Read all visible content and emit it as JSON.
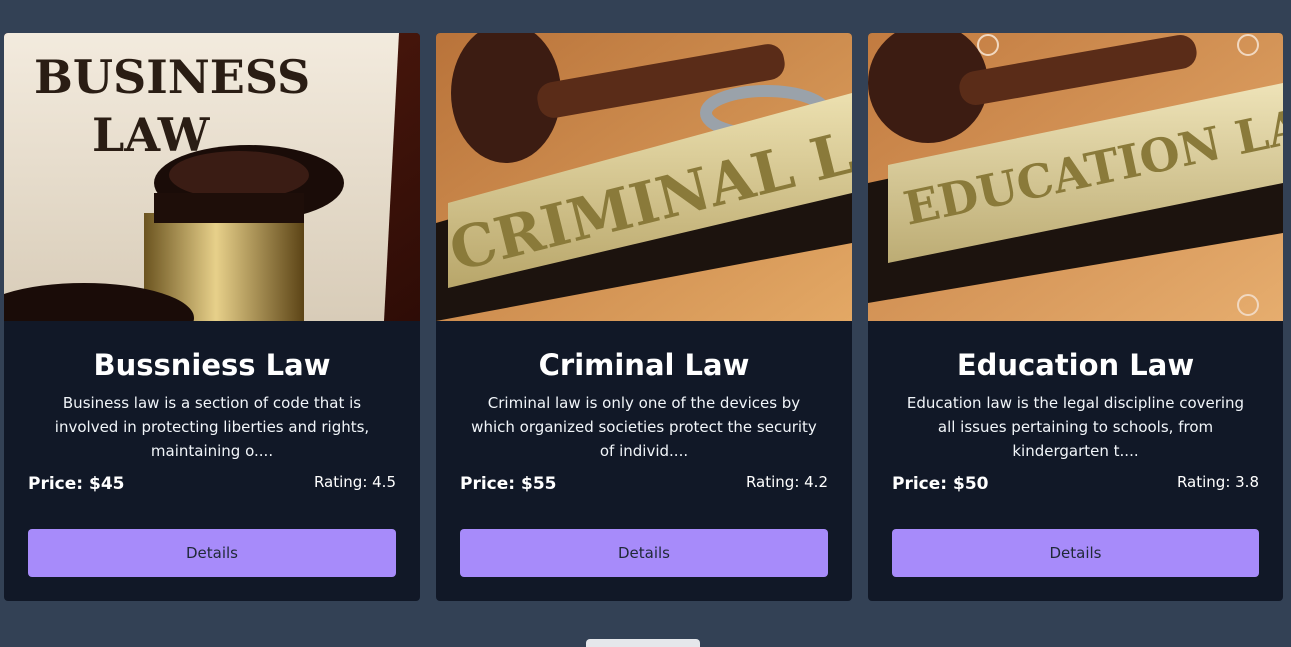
{
  "cards": [
    {
      "title": "Bussniess Law",
      "description": "Business law is a section of code that is involved in protecting liberties and rights, maintaining o....",
      "price": "Price: $45",
      "rating": "Rating: 4.5",
      "button_label": "Details",
      "image_text_1": "BUSINESS",
      "image_text_2": "LAW"
    },
    {
      "title": "Criminal Law",
      "description": "Criminal law is only one of the devices by which organized societies protect the security of individ....",
      "price": "Price: $55",
      "rating": "Rating: 4.2",
      "button_label": "Details",
      "image_text_1": "CRIMINAL LA"
    },
    {
      "title": "Education Law",
      "description": "Education law is the legal discipline covering all issues pertaining to schools, from kindergarten t....",
      "price": "Price: $50",
      "rating": "Rating: 3.8",
      "button_label": "Details",
      "image_text_1": "EDUCATION LA"
    }
  ],
  "colors": {
    "page_bg": "#334155",
    "card_bg": "#111827",
    "button_bg": "#a78bfa"
  }
}
